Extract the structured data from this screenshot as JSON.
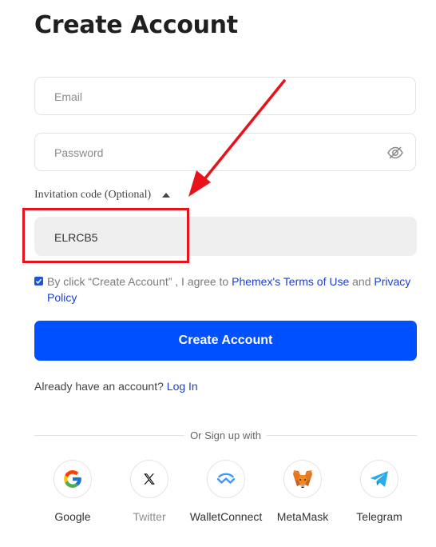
{
  "title": "Create Account",
  "form": {
    "email_placeholder": "Email",
    "password_placeholder": "Password",
    "invitation_label": "Invitation code (Optional)",
    "invitation_value": "ELRCB5"
  },
  "agreement": {
    "prefix": "By click “Create Account” , I agree to ",
    "terms_link": "Phemex's Terms of Use",
    "and": " and ",
    "privacy_link": "Privacy Policy",
    "checked": true
  },
  "submit_label": "Create Account",
  "login": {
    "prompt": "Already have an account? ",
    "link": "Log In"
  },
  "divider_text": "Or Sign up with",
  "socials": [
    {
      "label": "Google",
      "icon": "google-icon"
    },
    {
      "label": "Twitter",
      "icon": "x-icon"
    },
    {
      "label": "WalletConnect",
      "icon": "walletconnect-icon"
    },
    {
      "label": "MetaMask",
      "icon": "metamask-fox-icon"
    },
    {
      "label": "Telegram",
      "icon": "telegram-icon"
    }
  ],
  "colors": {
    "primary": "#0050ff",
    "link": "#1a3fd0",
    "annotation": "#e8121b"
  }
}
